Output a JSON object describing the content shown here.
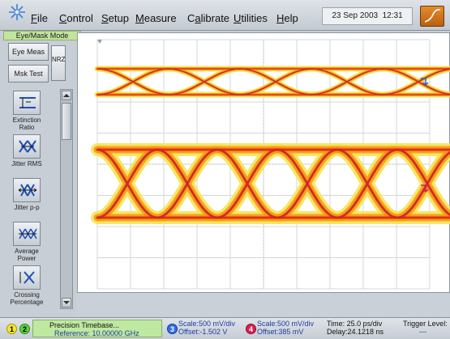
{
  "menubar": {
    "items": [
      "File",
      "Control",
      "Setup",
      "Measure",
      "Calibrate",
      "Utilities",
      "Help"
    ],
    "date": "23 Sep 2003",
    "time": "12:31"
  },
  "left_panel": {
    "mode_label": "Eye/Mask Mode",
    "eye_meas_label": "Eye Meas",
    "msk_test_label": "Msk Test",
    "nrz_label": "NRZ",
    "tools": [
      {
        "label": "Extinction Ratio",
        "icon": "extinction-ratio-icon"
      },
      {
        "label": "Jitter RMS",
        "icon": "jitter-rms-icon"
      },
      {
        "label": "Jitter p-p",
        "icon": "jitter-pp-icon"
      },
      {
        "label": "Average Power",
        "icon": "average-power-icon"
      },
      {
        "label": "Crossing Percentage",
        "icon": "crossing-percentage-icon"
      }
    ]
  },
  "colors": {
    "trace_core": "#e0231a",
    "trace_mid": "#f39a12",
    "trace_outer": "#f6e35a",
    "trace_edge": "#7a2a7a",
    "ch3_marker": "#1e63d6",
    "ch4_marker": "#d81b60",
    "status_green": "#bfe8a0"
  },
  "status": {
    "ch1": "1",
    "ch2": "2",
    "timebase_title": "Precision Timebase...",
    "timebase_ref": "Reference: 10.00000 GHz",
    "ch3": "3",
    "ch3_scale": "Scale:500 mV/div",
    "ch3_offset": "Offset:-1.502 V",
    "ch4": "4",
    "ch4_scale": "Scale:500 mV/div",
    "ch4_offset": "Offset:385 mV",
    "time_label": "Time: 25.0 ps/div",
    "delay_label": "Delay:24.1218 ns",
    "trigger_label": "Trigger Level:",
    "trigger_value": "---"
  }
}
